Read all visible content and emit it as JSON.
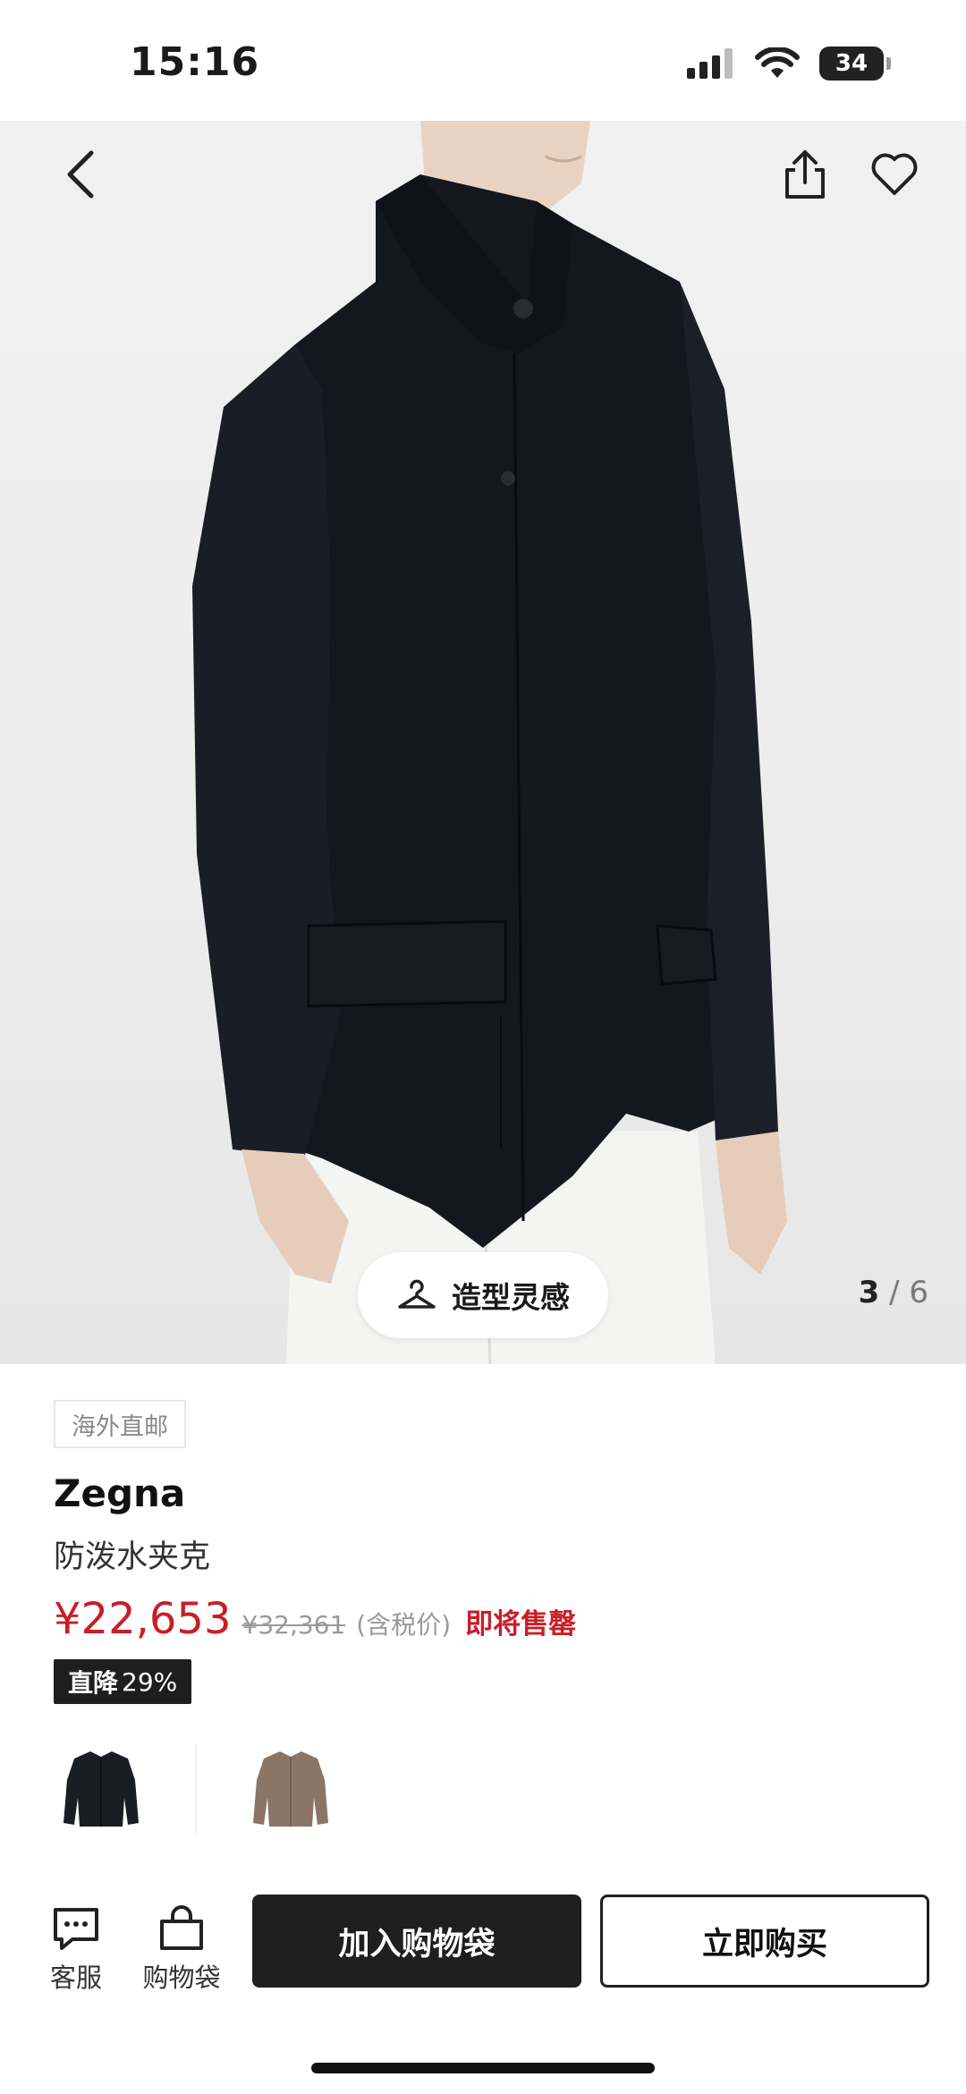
{
  "status_bar": {
    "time": "15:16",
    "battery": "34"
  },
  "gallery": {
    "style_inspiration_label": "造型灵感",
    "pager_current": "3",
    "pager_separator": "/",
    "pager_total": "6"
  },
  "product": {
    "tag": "海外直邮",
    "brand": "Zegna",
    "name": "防泼水夹克",
    "price_current": "¥22,653",
    "price_original": "¥32,361",
    "price_note": "(含税价)",
    "stock_status": "即将售罄",
    "discount_prefix": "直降",
    "discount_value": "29%"
  },
  "swatches": [
    {
      "name": "black",
      "color": "#1b1d24"
    },
    {
      "name": "brown",
      "color": "#8a7566"
    }
  ],
  "bottom_bar": {
    "service_label": "客服",
    "bag_label": "购物袋",
    "add_to_bag_label": "加入购物袋",
    "buy_now_label": "立即购买"
  }
}
